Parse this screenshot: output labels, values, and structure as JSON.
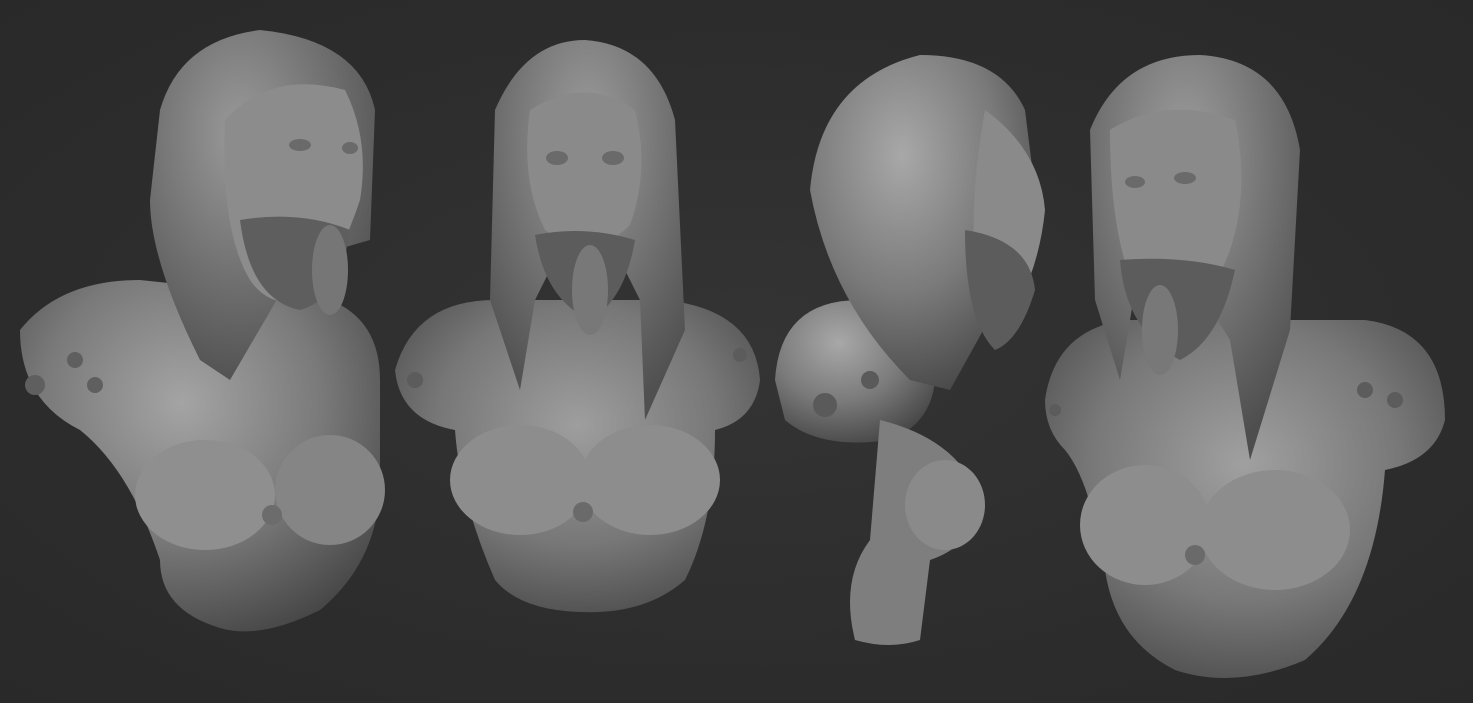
{
  "scene": {
    "background_color": "#2e2e2e",
    "material_color": "#8a8a8a",
    "views": [
      {
        "view": "three-quarter-right"
      },
      {
        "view": "front"
      },
      {
        "view": "side-profile"
      },
      {
        "view": "three-quarter-left"
      }
    ]
  }
}
